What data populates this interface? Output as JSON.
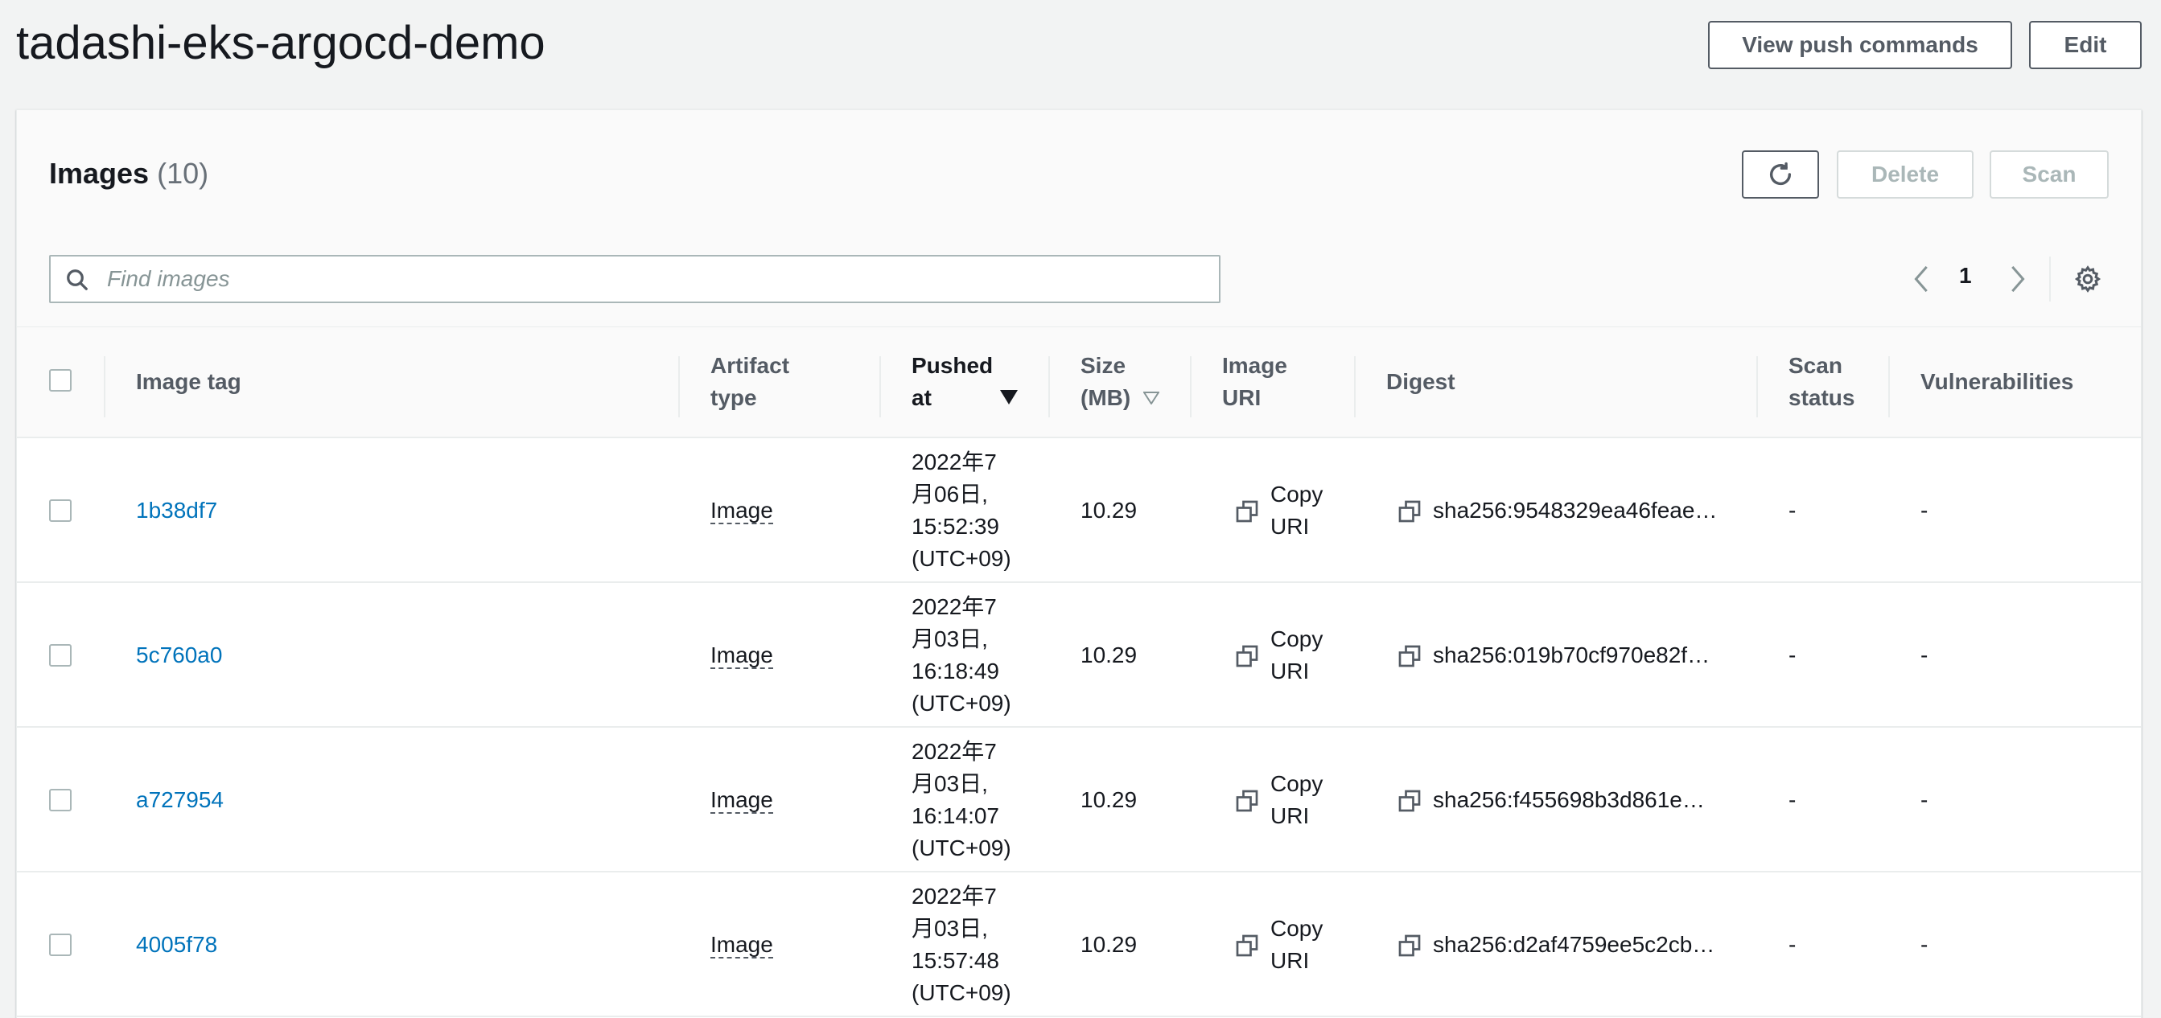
{
  "header": {
    "title": "tadashi-eks-argocd-demo",
    "push_label": "View push commands",
    "edit_label": "Edit"
  },
  "panel": {
    "title": "Images",
    "count": "(10)",
    "delete_label": "Delete",
    "scan_label": "Scan",
    "search_placeholder": "Find images",
    "page": "1"
  },
  "columns": {
    "tag": "Image tag",
    "artifact_1": "Artifact",
    "artifact_2": "type",
    "pushed_1": "Pushed",
    "pushed_2": "at",
    "size_1": "Size",
    "size_2": "(MB)",
    "uri_1": "Image",
    "uri_2": "URI",
    "digest": "Digest",
    "scan_1": "Scan",
    "scan_2": "status",
    "vuln": "Vulnerabilities"
  },
  "rows": [
    {
      "tag": "1b38df7",
      "type": "Image",
      "p1": "2022年7",
      "p2": "月06日,",
      "p3": "15:52:39",
      "p4": "(UTC+09)",
      "size": "10.29",
      "copy1": "Copy",
      "copy2": "URI",
      "digest": "sha256:9548329ea46feae…",
      "scan": "-",
      "vuln": "-"
    },
    {
      "tag": "5c760a0",
      "type": "Image",
      "p1": "2022年7",
      "p2": "月03日,",
      "p3": "16:18:49",
      "p4": "(UTC+09)",
      "size": "10.29",
      "copy1": "Copy",
      "copy2": "URI",
      "digest": "sha256:019b70cf970e82f…",
      "scan": "-",
      "vuln": "-"
    },
    {
      "tag": "a727954",
      "type": "Image",
      "p1": "2022年7",
      "p2": "月03日,",
      "p3": "16:14:07",
      "p4": "(UTC+09)",
      "size": "10.29",
      "copy1": "Copy",
      "copy2": "URI",
      "digest": "sha256:f455698b3d861e…",
      "scan": "-",
      "vuln": "-"
    },
    {
      "tag": "4005f78",
      "type": "Image",
      "p1": "2022年7",
      "p2": "月03日,",
      "p3": "15:57:48",
      "p4": "(UTC+09)",
      "size": "10.29",
      "copy1": "Copy",
      "copy2": "URI",
      "digest": "sha256:d2af4759ee5c2cb…",
      "scan": "-",
      "vuln": "-"
    }
  ]
}
